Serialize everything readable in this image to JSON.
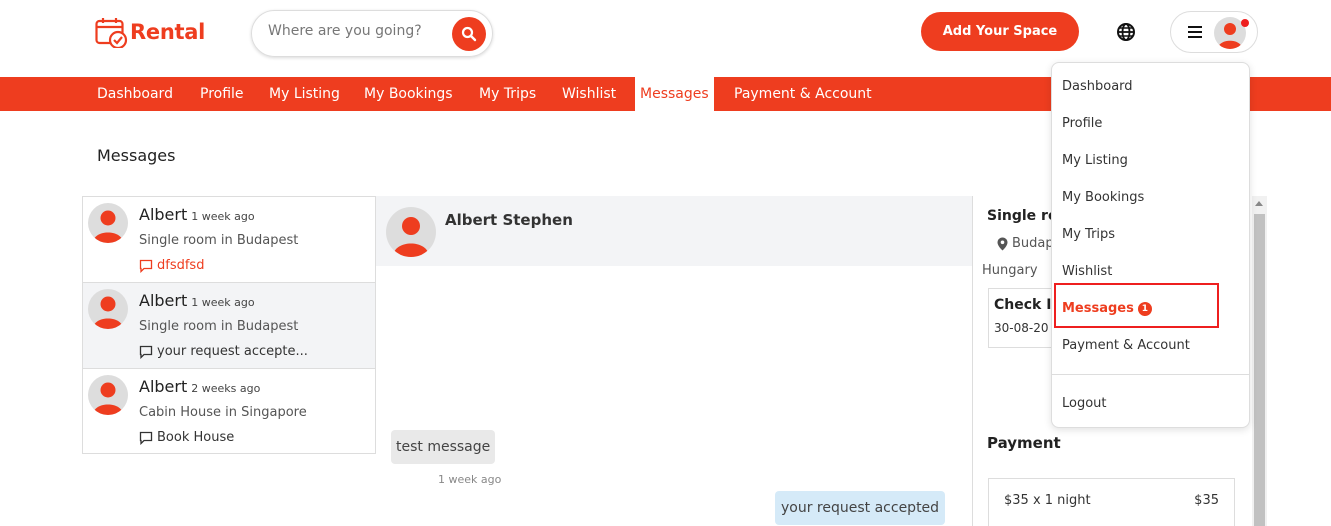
{
  "header": {
    "logo_text": "Rental",
    "search_placeholder": "Where are you going?",
    "add_space_label": "Add Your Space",
    "brand_color": "#ee3d1f"
  },
  "nav": {
    "items": [
      {
        "label": "Dashboard"
      },
      {
        "label": "Profile"
      },
      {
        "label": "My Listing"
      },
      {
        "label": "My Bookings"
      },
      {
        "label": "My Trips"
      },
      {
        "label": "Wishlist"
      },
      {
        "label": "Messages",
        "active": true
      },
      {
        "label": "Payment & Account"
      }
    ]
  },
  "page": {
    "title": "Messages"
  },
  "conversations": [
    {
      "name": "Albert",
      "time": "1 week ago",
      "listing": "Single room in Budapest",
      "message": "dfsdfsd",
      "highlight": true
    },
    {
      "name": "Albert",
      "time": "1 week ago",
      "listing": "Single room in Budapest",
      "message": "your request accepte...",
      "selected": true
    },
    {
      "name": "Albert",
      "time": "2 weeks ago",
      "listing": "Cabin House in Singapore",
      "message": "Book House"
    }
  ],
  "chat": {
    "contact_name": "Albert Stephen",
    "messages": [
      {
        "text": "test message",
        "time": "1 week ago",
        "direction": "incoming"
      },
      {
        "text": "your request accepted",
        "direction": "outgoing"
      }
    ]
  },
  "details": {
    "title": "Single ro",
    "location": "Budap",
    "country": "Hungary",
    "check_in_label": "Check In",
    "check_in_date": "30-08-20",
    "payment_title": "Payment",
    "payment_line": "$35 x 1 night",
    "payment_amount": "$35"
  },
  "dropdown": {
    "items": [
      {
        "label": "Dashboard"
      },
      {
        "label": "Profile"
      },
      {
        "label": "My Listing"
      },
      {
        "label": "My Bookings"
      },
      {
        "label": "My Trips"
      },
      {
        "label": "Wishlist"
      },
      {
        "label": "Messages",
        "badge": "1",
        "active": true
      },
      {
        "label": "Payment & Account"
      },
      {
        "label": "Logout"
      }
    ]
  }
}
